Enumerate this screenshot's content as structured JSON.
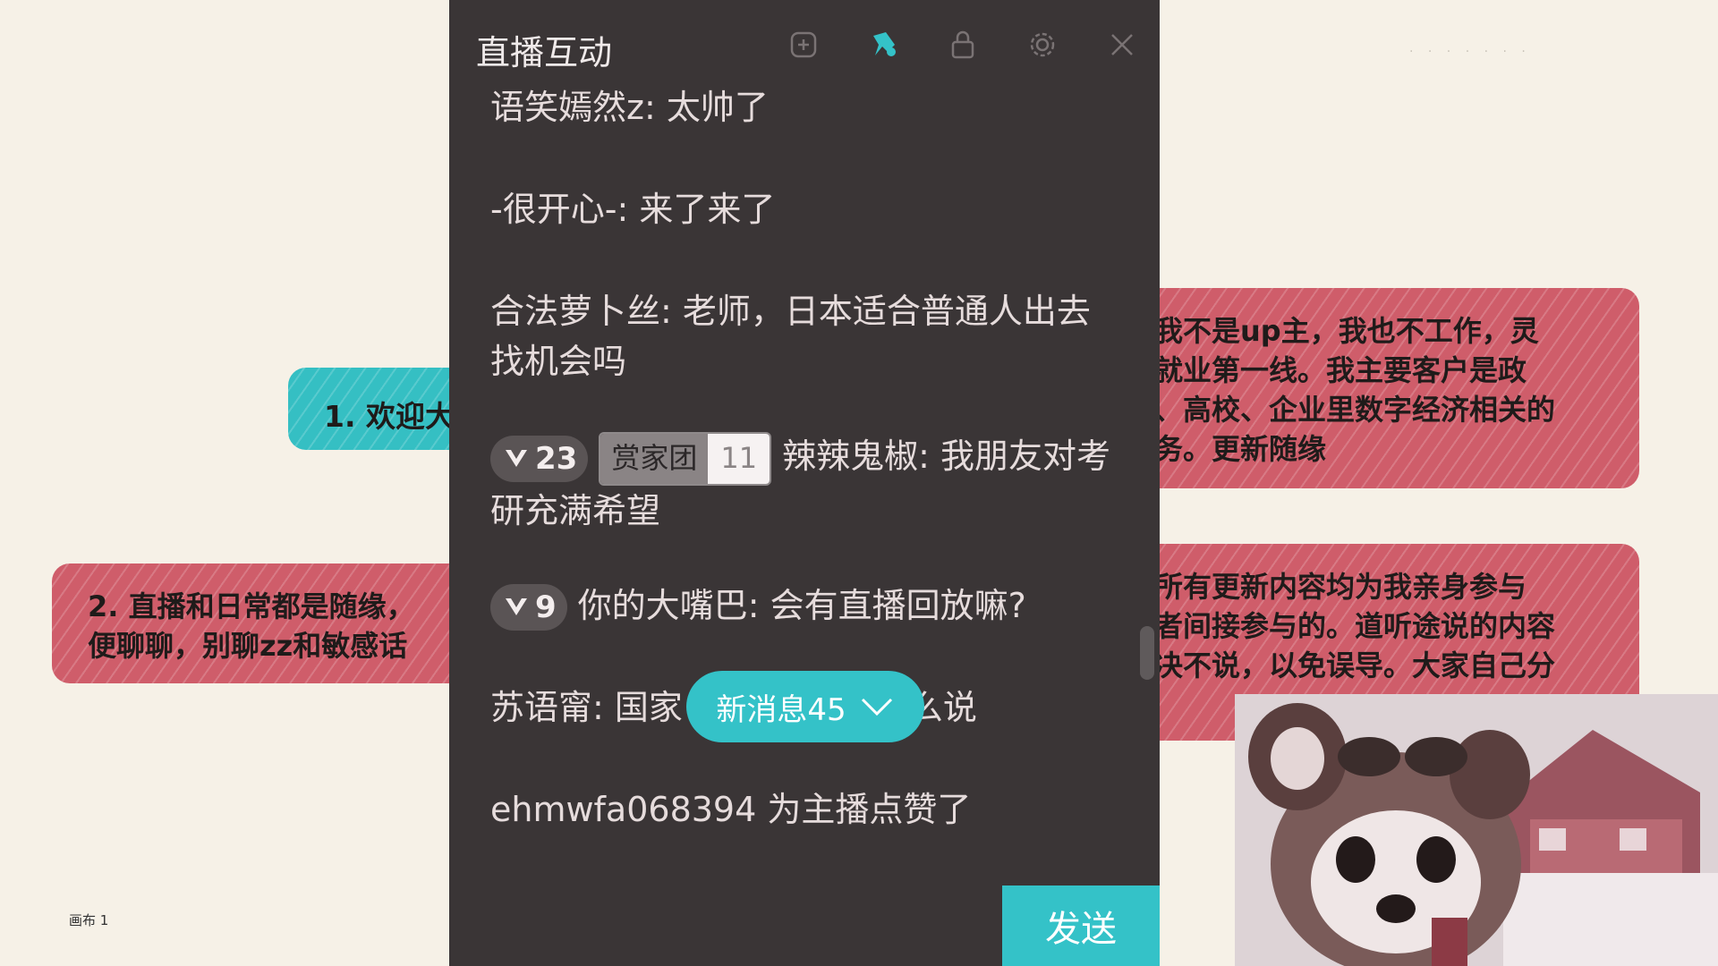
{
  "background_notes": {
    "teal": {
      "text": "1. 欢迎大"
    },
    "red_left": {
      "lines": [
        "2. 直播和日常都是随缘，",
        "便聊聊，别聊zz和敏感话"
      ]
    },
    "red_right_1": {
      "lines": [
        "我不是up主，我也不工作，灵",
        "就业第一线。我主要客户是政",
        "、高校、企业里数字经济相关的",
        "务。更新随缘"
      ]
    },
    "red_right_2": {
      "lines": [
        "所有更新内容均为我亲身参与",
        "者间接参与的。道听途说的内容",
        "决不说，以免误导。大家自己分"
      ]
    }
  },
  "canvas_label": "画布 1",
  "top_right_text": "· · · · ·  ·  ·",
  "chat": {
    "title": "直播互动",
    "header_icons": [
      "compact-mode-icon",
      "pin-icon",
      "lock-icon",
      "gear-icon",
      "close-icon"
    ],
    "messages": [
      {
        "user": "语笑嫣然z",
        "text": "太帅了"
      },
      {
        "user": "-很开心-",
        "text": "来了来了"
      },
      {
        "user": "合法萝卜丝",
        "text": "老师，日本适合普通人出去找机会吗"
      },
      {
        "level": "23",
        "fan_badge": "赏家团",
        "fan_level": "11",
        "user": "辣辣鬼椒",
        "text": "我朋友对考研充满希望"
      },
      {
        "level": "9",
        "user": "你的大嘴巴",
        "text": "会有直播回放嘛?"
      },
      {
        "user": "苏语甯",
        "text": "国家",
        "tail": "怎么说"
      },
      {
        "system": "ehmwfa068394 为主播点赞了"
      }
    ],
    "new_message_pill": "新消息45",
    "send_label": "发送"
  },
  "colors": {
    "panel_bg": "#3a3536",
    "accent_teal": "#34c2c8",
    "note_red": "#cf5d6a",
    "note_teal": "#35bfc3",
    "canvas_bg": "#f6f1e7"
  }
}
